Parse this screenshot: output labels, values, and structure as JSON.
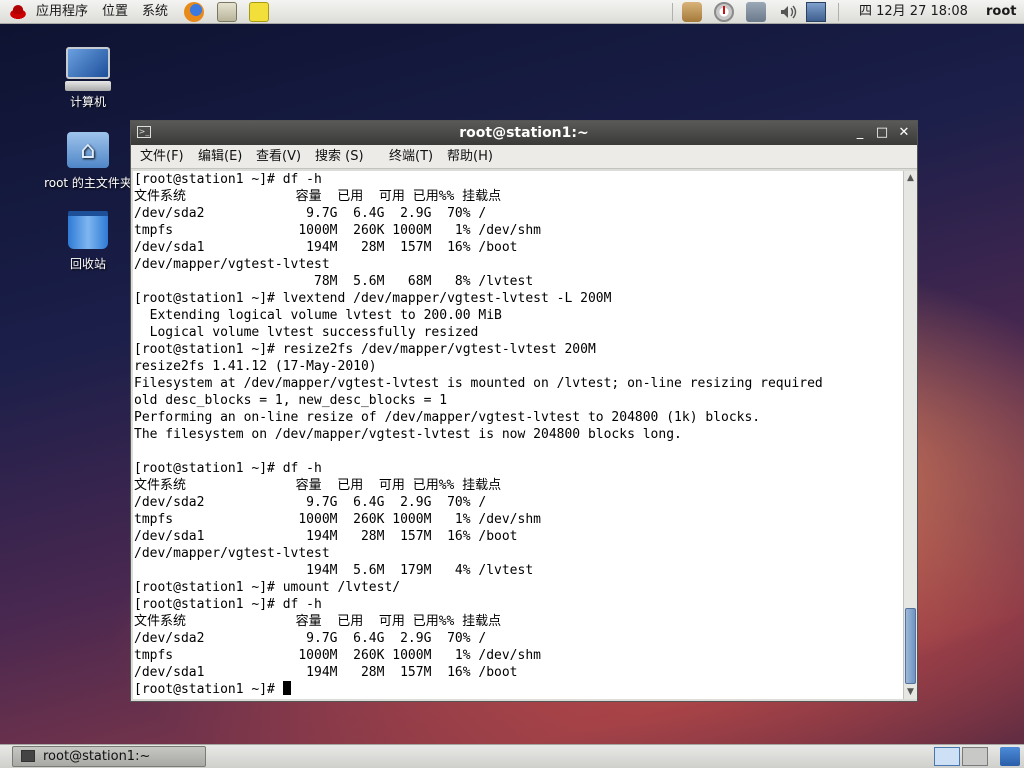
{
  "top_panel": {
    "menus": [
      "应用程序",
      "位置",
      "系统"
    ],
    "clock": "四 12月 27 18:08",
    "user": "root"
  },
  "desktop": {
    "icons": [
      {
        "label": "计算机"
      },
      {
        "label": "root 的主文件夹"
      },
      {
        "label": "回收站"
      }
    ]
  },
  "window": {
    "title": "root@station1:~",
    "controls": {
      "minimize": "_",
      "maximize": "□",
      "close": "✕"
    },
    "menu": [
      "文件(F)",
      "编辑(E)",
      "查看(V)",
      "搜索 (S)",
      "终端(T)",
      "帮助(H)"
    ],
    "terminal_lines": [
      "[root@station1 ~]# df -h",
      "文件系统              容量  已用  可用 已用%% 挂载点",
      "/dev/sda2             9.7G  6.4G  2.9G  70% /",
      "tmpfs                1000M  260K 1000M   1% /dev/shm",
      "/dev/sda1             194M   28M  157M  16% /boot",
      "/dev/mapper/vgtest-lvtest",
      "                       78M  5.6M   68M   8% /lvtest",
      "[root@station1 ~]# lvextend /dev/mapper/vgtest-lvtest -L 200M",
      "  Extending logical volume lvtest to 200.00 MiB",
      "  Logical volume lvtest successfully resized",
      "[root@station1 ~]# resize2fs /dev/mapper/vgtest-lvtest 200M",
      "resize2fs 1.41.12 (17-May-2010)",
      "Filesystem at /dev/mapper/vgtest-lvtest is mounted on /lvtest; on-line resizing required",
      "old desc_blocks = 1, new_desc_blocks = 1",
      "Performing an on-line resize of /dev/mapper/vgtest-lvtest to 204800 (1k) blocks.",
      "The filesystem on /dev/mapper/vgtest-lvtest is now 204800 blocks long.",
      "",
      "[root@station1 ~]# df -h",
      "文件系统              容量  已用  可用 已用%% 挂载点",
      "/dev/sda2             9.7G  6.4G  2.9G  70% /",
      "tmpfs                1000M  260K 1000M   1% /dev/shm",
      "/dev/sda1             194M   28M  157M  16% /boot",
      "/dev/mapper/vgtest-lvtest",
      "                      194M  5.6M  179M   4% /lvtest",
      "[root@station1 ~]# umount /lvtest/",
      "[root@station1 ~]# df -h",
      "文件系统              容量  已用  可用 已用%% 挂载点",
      "/dev/sda2             9.7G  6.4G  2.9G  70% /",
      "tmpfs                1000M  260K 1000M   1% /dev/shm",
      "/dev/sda1             194M   28M  157M  16% /boot"
    ],
    "prompt": "[root@station1 ~]# "
  },
  "taskbar": {
    "task_label": "root@station1:~"
  }
}
